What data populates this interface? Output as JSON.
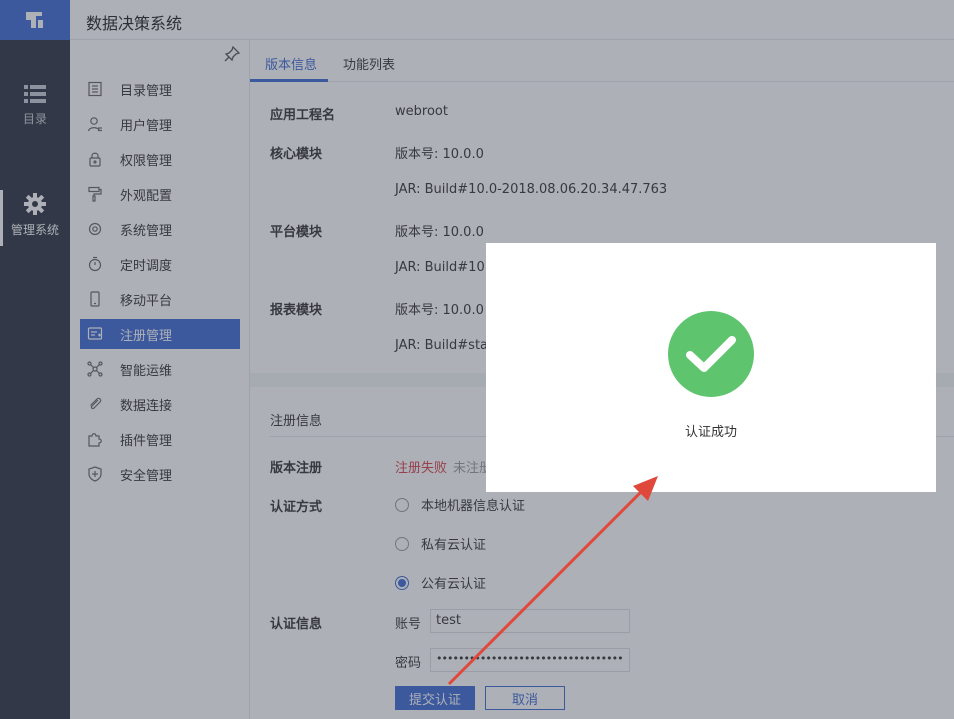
{
  "app": {
    "title": "数据决策系统"
  },
  "rail": {
    "items": [
      {
        "label": "目录",
        "icon": "list-icon"
      },
      {
        "label": "管理系统",
        "icon": "gear-icon"
      }
    ]
  },
  "subnav": {
    "items": [
      {
        "label": "目录管理",
        "icon": "catalog-icon"
      },
      {
        "label": "用户管理",
        "icon": "user-icon"
      },
      {
        "label": "权限管理",
        "icon": "lock-icon"
      },
      {
        "label": "外观配置",
        "icon": "paint-roller-icon"
      },
      {
        "label": "系统管理",
        "icon": "settings-icon"
      },
      {
        "label": "定时调度",
        "icon": "timer-icon"
      },
      {
        "label": "移动平台",
        "icon": "mobile-icon"
      },
      {
        "label": "注册管理",
        "icon": "register-icon",
        "active": true
      },
      {
        "label": "智能运维",
        "icon": "network-icon"
      },
      {
        "label": "数据连接",
        "icon": "paperclip-icon"
      },
      {
        "label": "插件管理",
        "icon": "puzzle-icon"
      },
      {
        "label": "安全管理",
        "icon": "shield-icon"
      }
    ]
  },
  "tabs": [
    {
      "label": "版本信息",
      "active": true
    },
    {
      "label": "功能列表",
      "active": false
    }
  ],
  "version_info": {
    "app_project_label": "应用工程名",
    "app_project_value": "webroot",
    "core_label": "核心模块",
    "core_version": "版本号: 10.0.0",
    "core_jar": "JAR: Build#10.0-2018.08.06.20.34.47.763",
    "platform_label": "平台模块",
    "platform_version": "版本号: 10.0.0",
    "platform_jar": "JAR: Build#10.0-",
    "report_label": "报表模块",
    "report_version": "版本号: 10.0.0",
    "report_jar": "JAR: Build#stabl"
  },
  "registration": {
    "section_title": "注册信息",
    "version_reg_label": "版本注册",
    "status_fail": "注册失败",
    "status_hint": "未注册",
    "auth_method_label": "认证方式",
    "auth_options": [
      {
        "label": "本地机器信息认证",
        "checked": false
      },
      {
        "label": "私有云认证",
        "checked": false
      },
      {
        "label": "公有云认证",
        "checked": true
      }
    ],
    "auth_info_label": "认证信息",
    "account_label": "账号",
    "account_value": "test",
    "password_label": "密码",
    "password_value": "••••••••••••••••••••••••••••••••••",
    "submit_label": "提交认证",
    "cancel_label": "取消"
  },
  "dialog": {
    "message": "认证成功",
    "icon": "checkmark-circle-icon",
    "icon_color": "#5ec46e"
  },
  "colors": {
    "accent": "#3d6ad6",
    "rail": "#2c3140",
    "error": "#d8404a",
    "annotation_arrow": "#e0483c"
  }
}
